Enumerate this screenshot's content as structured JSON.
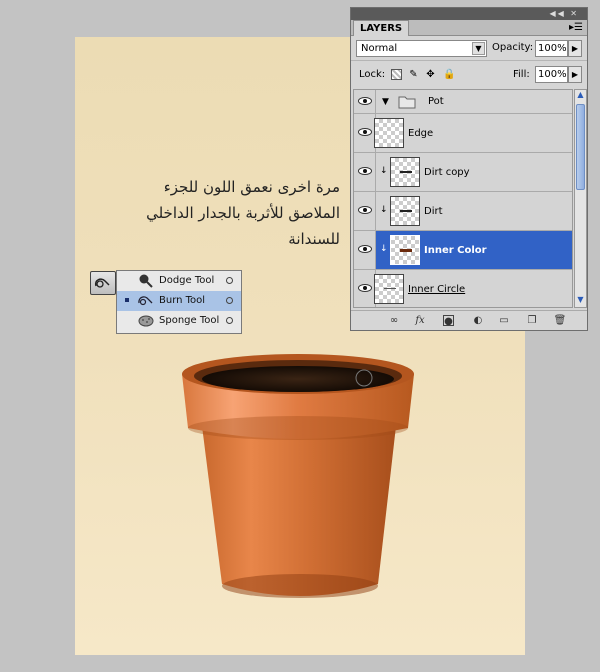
{
  "annotation": {
    "lines": [
      "مرة اخرى نعمق اللون للجزء",
      "الملاصق للأثربة بالجدار الداخلي",
      "للسندانة"
    ]
  },
  "tool_flyout": {
    "items": [
      {
        "label": "Dodge Tool",
        "icon": "dodge-icon",
        "selected": false
      },
      {
        "label": "Burn Tool",
        "icon": "burn-icon",
        "selected": true
      },
      {
        "label": "Sponge Tool",
        "icon": "sponge-icon",
        "selected": false
      }
    ]
  },
  "layers_panel": {
    "tab_label": "LAYERS",
    "blend_mode": "Normal",
    "opacity_label": "Opacity:",
    "opacity_value": "100%",
    "lock_label": "Lock:",
    "fill_label": "Fill:",
    "fill_value": "100%",
    "layers": [
      {
        "name": "Pot",
        "type": "group"
      },
      {
        "name": "Edge",
        "type": "layer"
      },
      {
        "name": "Dirt copy",
        "type": "clipped"
      },
      {
        "name": "Dirt",
        "type": "clipped"
      },
      {
        "name": "Inner Color",
        "type": "clipped",
        "active": true
      },
      {
        "name": "Inner Circle",
        "type": "layer"
      }
    ],
    "footer_icons": [
      "link-icon",
      "fx-icon",
      "mask-icon",
      "adjustment-icon",
      "folder-icon",
      "new-layer-icon",
      "trash-icon"
    ]
  },
  "colors": {
    "canvas_top": "#ecdcb4",
    "canvas_bottom": "#f6e8c8",
    "selection_blue": "#3162c6",
    "pot_terracotta": "#d8733a"
  }
}
